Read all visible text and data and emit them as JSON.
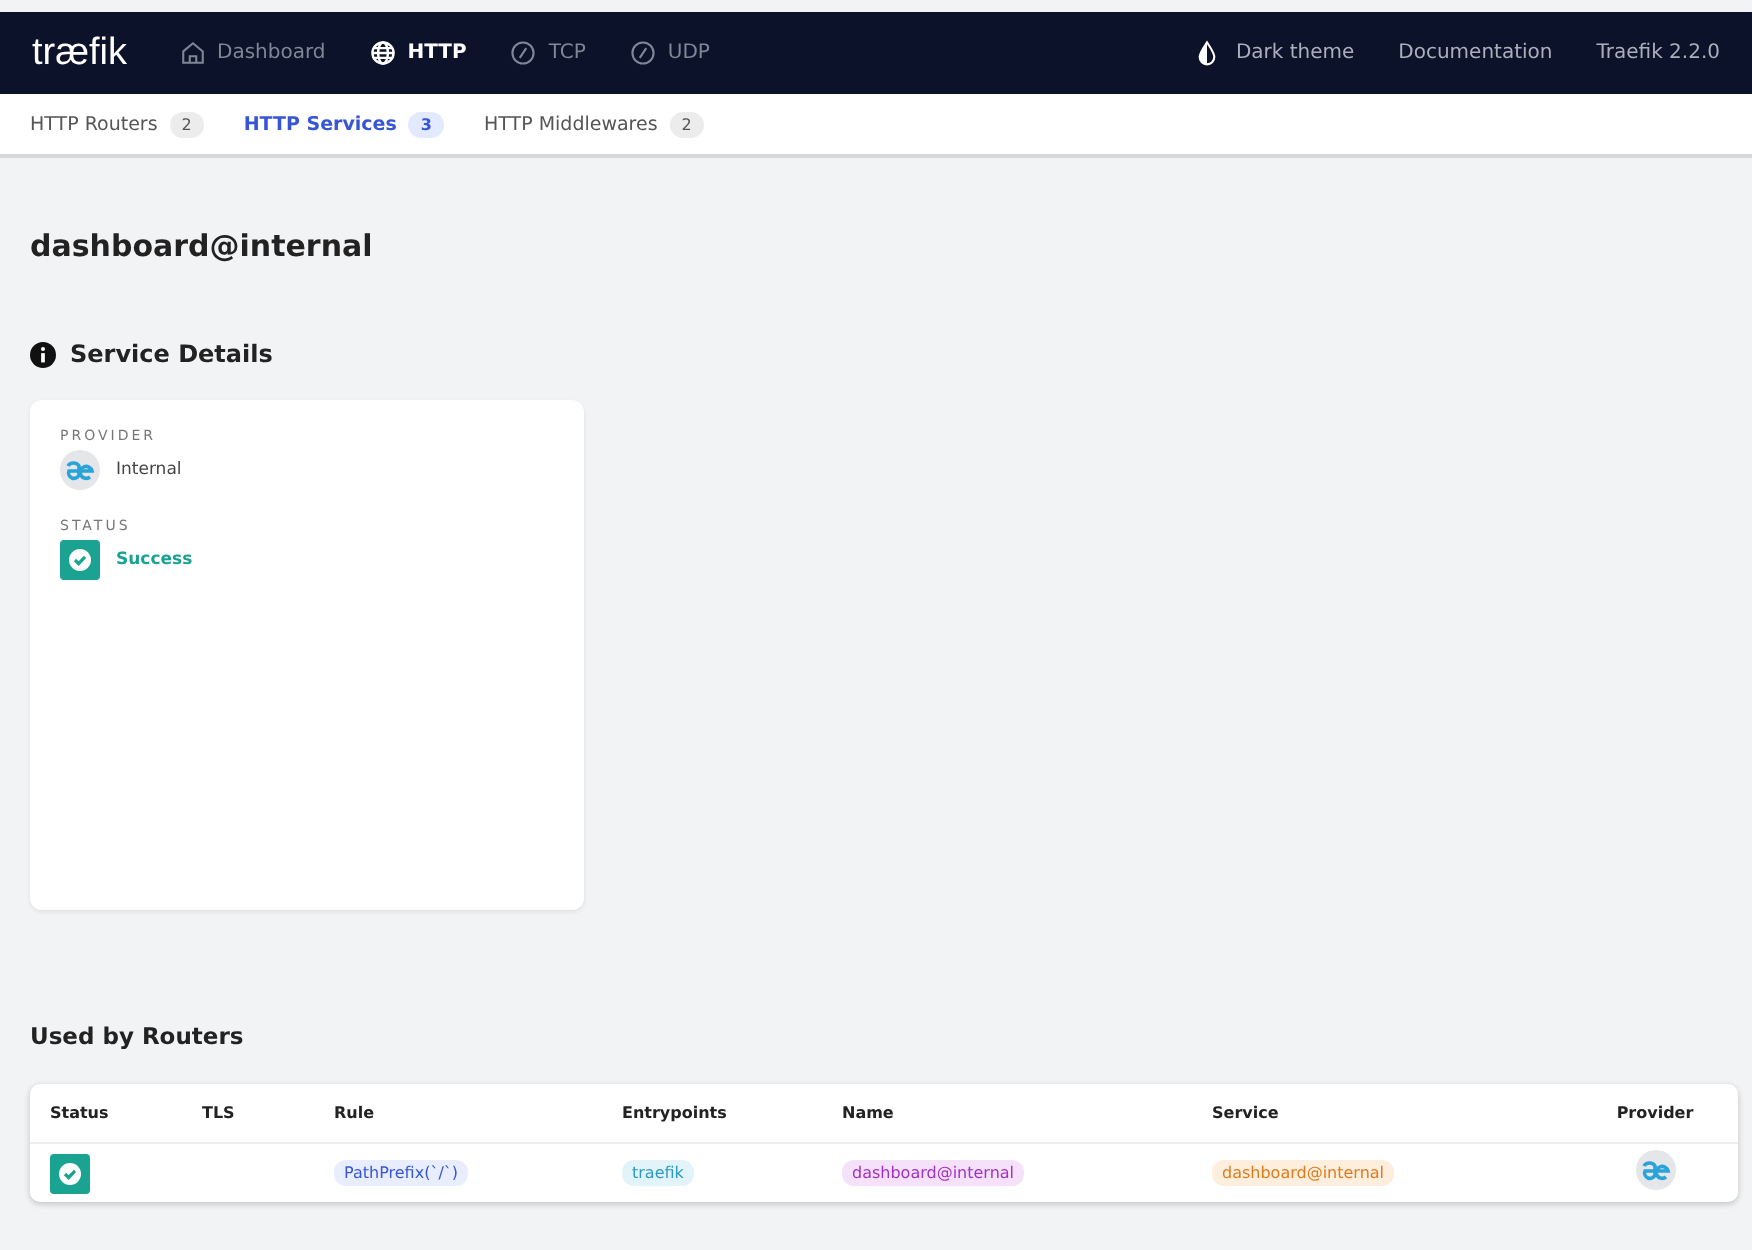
{
  "navbar": {
    "logo": "træfik",
    "items": [
      {
        "label": "Dashboard",
        "kind": "home",
        "selected": false
      },
      {
        "label": "HTTP",
        "kind": "globe",
        "selected": true
      },
      {
        "label": "TCP",
        "kind": "gauge",
        "selected": false
      },
      {
        "label": "UDP",
        "kind": "gauge",
        "selected": false
      }
    ],
    "right": [
      {
        "label": "Dark theme",
        "kind": "theme"
      },
      {
        "label": "Documentation",
        "kind": "link"
      },
      {
        "label": "Traefik 2.2.0",
        "kind": "link"
      }
    ]
  },
  "subnav": [
    {
      "label": "HTTP Routers",
      "count": "2",
      "selected": false
    },
    {
      "label": "HTTP Services",
      "count": "3",
      "selected": true
    },
    {
      "label": "HTTP Middlewares",
      "count": "2",
      "selected": false
    }
  ],
  "title": "dashboard@internal",
  "details": {
    "heading": "Service Details",
    "provider_label": "PROVIDER",
    "provider": "Internal",
    "status_label": "STATUS",
    "status": {
      "kind": "success",
      "text": "Success"
    }
  },
  "routers": {
    "heading": "Used by Routers",
    "columns": [
      "Status",
      "TLS",
      "Rule",
      "Entrypoints",
      "Name",
      "Service",
      "Provider"
    ],
    "rows": [
      {
        "kind": "success",
        "rule": "PathPrefix(`/`)",
        "entrypoints": "traefik",
        "name": "dashboard@internal",
        "service": "dashboard@internal"
      }
    ]
  }
}
